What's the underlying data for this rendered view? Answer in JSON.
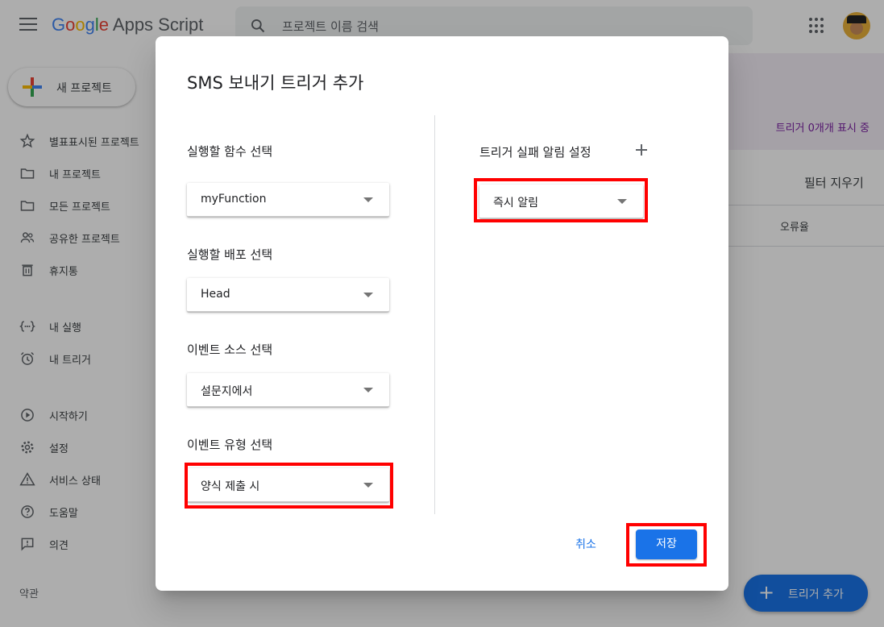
{
  "app": {
    "logo_text": "Google Apps Script",
    "search_placeholder": "프로젝트 이름 검색",
    "new_project": "새 프로젝트",
    "sidebar": [
      {
        "label": "별표표시된 프로젝트",
        "icon": "star-icon"
      },
      {
        "label": "내 프로젝트",
        "icon": "folder-icon"
      },
      {
        "label": "모든 프로젝트",
        "icon": "folder-icon"
      },
      {
        "label": "공유한 프로젝트",
        "icon": "people-icon"
      },
      {
        "label": "휴지통",
        "icon": "trash-icon"
      },
      {
        "label": "내 실행",
        "icon": "executions-icon"
      },
      {
        "label": "내 트리거",
        "icon": "alarm-icon"
      },
      {
        "label": "시작하기",
        "icon": "play-icon"
      },
      {
        "label": "설정",
        "icon": "gear-icon"
      },
      {
        "label": "서비스 상태",
        "icon": "warning-icon"
      },
      {
        "label": "도움말",
        "icon": "help-icon"
      },
      {
        "label": "의견",
        "icon": "feedback-icon"
      }
    ],
    "terms": "약관",
    "status_text": "트리거 0개개 표시 중",
    "filter_clear": "필터 지우기",
    "column_error_rate": "오류율",
    "fab_label": "트리거 추가"
  },
  "dialog": {
    "title": "SMS 보내기 트리거 추가",
    "fields": [
      {
        "label": "실행할 함수 선택",
        "value": "myFunction"
      },
      {
        "label": "실행할 배포 선택",
        "value": "Head"
      },
      {
        "label": "이벤트 소스 선택",
        "value": "설문지에서"
      },
      {
        "label": "이벤트 유형 선택",
        "value": "양식 제출 시"
      }
    ],
    "failure_notify_label": "트리거 실패 알림 설정",
    "failure_notify_value": "즉시 알림",
    "cancel": "취소",
    "save": "저장"
  },
  "colors": {
    "accent": "#1a73e8",
    "highlight": "#ff0000"
  }
}
